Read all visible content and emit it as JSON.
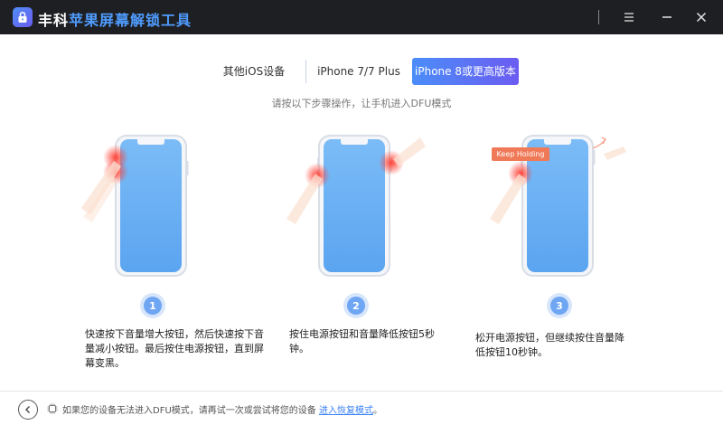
{
  "titlebar": {
    "brand": "丰科",
    "product": "苹果屏幕解锁工具"
  },
  "tabs": [
    {
      "label": "其他iOS设备",
      "active": false
    },
    {
      "label": "iPhone 7/7 Plus",
      "active": false
    },
    {
      "label": "iPhone 8或更高版本",
      "active": true
    }
  ],
  "subtitle": "请按以下步骤操作，让手机进入DFU模式",
  "steps": [
    {
      "number": "1",
      "text": [
        "快速按下音量增大按钮，然后快速按下音",
        "量减小按钮。最后按住电源按钮，直到屏",
        "幕变黑。"
      ]
    },
    {
      "number": "2",
      "text": [
        "按住电源按钮和音量降低按钮5秒",
        "钟。"
      ]
    },
    {
      "number": "3",
      "text": [
        "松开电源按钮，但继续按住音量降",
        "低按钮10秒钟。"
      ],
      "badge": "Keep Holding"
    }
  ],
  "footer": {
    "text": "如果您的设备无法进入DFU模式，请再试一次或尝试将您的设备",
    "link": "进入恢复模式",
    "suffix": "。"
  },
  "colors": {
    "titlebar": "#1e1f22",
    "accent_start": "#4b8df8",
    "accent_end": "#6b5cf1",
    "phone_screen": "#6db3f5",
    "badge": "#f07958",
    "step_circle": "#6fa6f4"
  }
}
